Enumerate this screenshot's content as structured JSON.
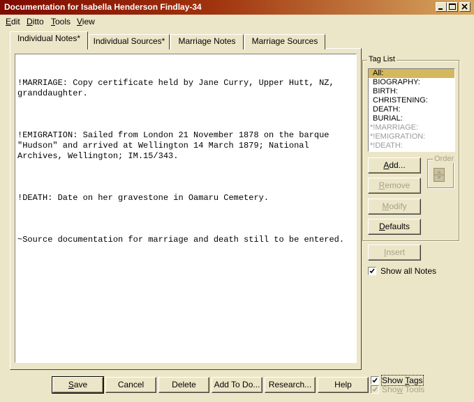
{
  "window": {
    "title": "Documentation for Isabella Henderson Findlay-34",
    "controls": [
      "minimize-icon",
      "maximize-icon",
      "close-icon"
    ]
  },
  "menu": [
    {
      "label": "Edit",
      "underline": "E"
    },
    {
      "label": "Ditto",
      "underline": "D"
    },
    {
      "label": "Tools",
      "underline": "T"
    },
    {
      "label": "View",
      "underline": "V"
    }
  ],
  "tabs": [
    {
      "label": "Individual Notes*",
      "active": true
    },
    {
      "label": "Individual Sources*",
      "active": false
    },
    {
      "label": "Marriage Notes",
      "active": false
    },
    {
      "label": "Marriage Sources",
      "active": false
    }
  ],
  "notes": {
    "paragraphs": [
      "!MARRIAGE: Copy certificate held by Jane Curry, Upper Hutt, NZ, granddaughter.",
      "!EMIGRATION: Sailed from London 21 November 1878 on the barque \"Hudson\" and arrived at Wellington 14 March 1879; National Archives, Wellington; IM.15/343.",
      "!DEATH: Date on her gravestone in Oamaru Cemetery.",
      "~Source documentation for marriage and death still to be entered."
    ]
  },
  "tag_list": {
    "label": "Tag List",
    "items": [
      {
        "label": "All:",
        "selected": true,
        "dim": false
      },
      {
        "label": "BIOGRAPHY:",
        "selected": false,
        "dim": false
      },
      {
        "label": "BIRTH:",
        "selected": false,
        "dim": false
      },
      {
        "label": "CHRISTENING:",
        "selected": false,
        "dim": false
      },
      {
        "label": "DEATH:",
        "selected": false,
        "dim": false
      },
      {
        "label": "BURIAL:",
        "selected": false,
        "dim": false
      },
      {
        "label": "*!MARRIAGE:",
        "selected": false,
        "dim": true
      },
      {
        "label": "*!EMIGRATION:",
        "selected": false,
        "dim": true
      },
      {
        "label": "*!DEATH:",
        "selected": false,
        "dim": true
      }
    ],
    "order_label": "Order",
    "buttons": {
      "add": "Add...",
      "remove": "Remove",
      "modify": "Modify",
      "defaults": "Defaults"
    }
  },
  "insert_label": "Insert",
  "show_all_notes": {
    "label": "Show all Notes",
    "checked": true
  },
  "bottom_buttons": {
    "save": "Save",
    "cancel": "Cancel",
    "delete": "Delete",
    "add_to_do": "Add To Do...",
    "research": "Research...",
    "help": "Help"
  },
  "show_tags": {
    "label": "Show Tags",
    "checked": true
  },
  "show_tools": {
    "label": "Show Tools",
    "checked": true,
    "disabled": true
  },
  "colors": {
    "face": "#ECE6C8",
    "title_start": "#7E0A00",
    "title_end": "#D8A860",
    "list_selection": "#D4B860"
  }
}
